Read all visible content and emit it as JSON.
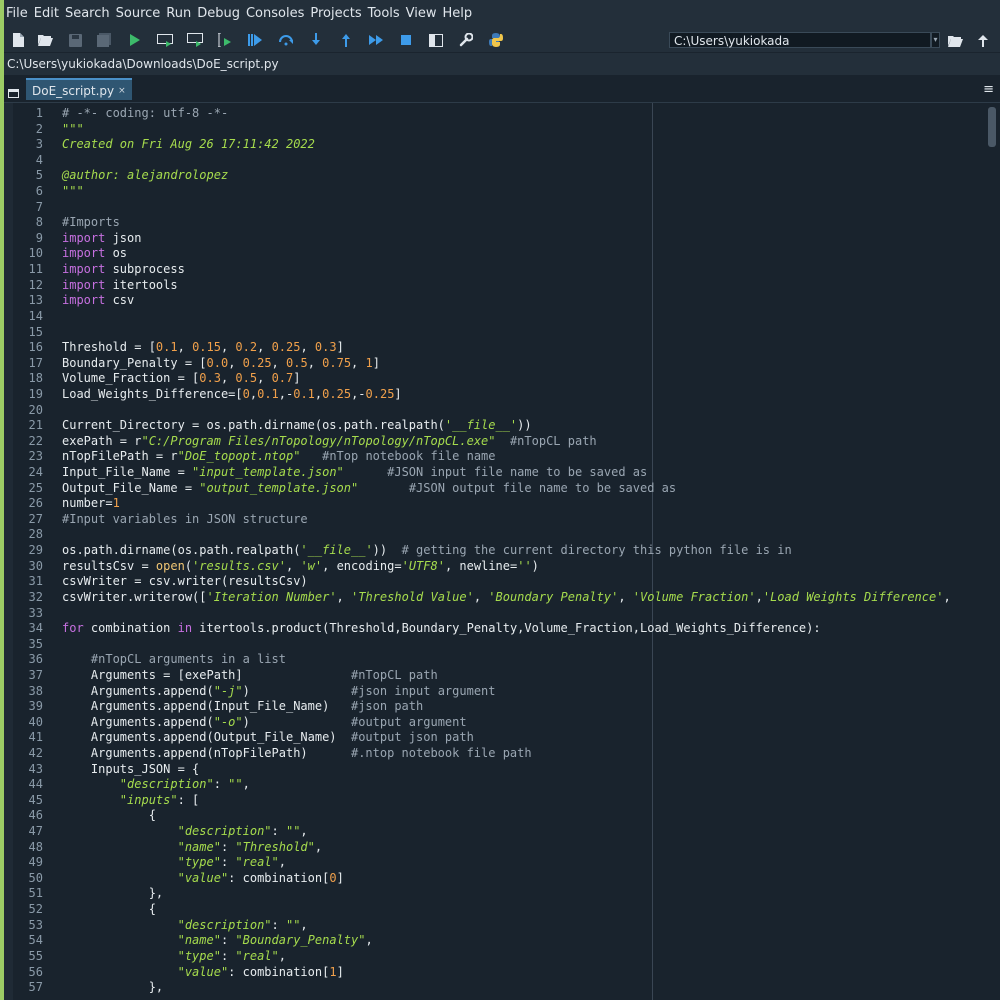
{
  "menu": [
    "File",
    "Edit",
    "Search",
    "Source",
    "Run",
    "Debug",
    "Consoles",
    "Projects",
    "Tools",
    "View",
    "Help"
  ],
  "toolbar_icons": [
    "new-file-icon",
    "open-file-icon",
    "save-icon",
    "save-all-icon",
    "run-icon",
    "run-cell-icon",
    "run-cell-advance-icon",
    "run-selection-icon",
    "debug-icon",
    "step-over-icon",
    "step-into-icon",
    "step-return-icon",
    "continue-icon",
    "stop-icon",
    "maximize-pane-icon",
    "preferences-icon",
    "python-path-icon"
  ],
  "cwd": {
    "value": "C:\\Users\\yukiokada"
  },
  "file_path": "C:\\Users\\yukiokada\\Downloads\\DoE_script.py",
  "tab": {
    "label": "DoE_script.py",
    "close": "×"
  },
  "code": {
    "lines": [
      [
        [
          "c",
          "# -*- coding: utf-8 -*-"
        ]
      ],
      [
        [
          "s",
          "\"\"\""
        ]
      ],
      [
        [
          "s",
          "Created on Fri Aug 26 17:11:42 2022"
        ]
      ],
      [
        [
          "t",
          ""
        ]
      ],
      [
        [
          "s",
          "@author: alejandrolopez"
        ]
      ],
      [
        [
          "s",
          "\"\"\""
        ]
      ],
      [
        [
          "t",
          ""
        ]
      ],
      [
        [
          "c",
          "#Imports"
        ]
      ],
      [
        [
          "k",
          "import"
        ],
        [
          "t",
          " json"
        ]
      ],
      [
        [
          "k",
          "import"
        ],
        [
          "t",
          " os"
        ]
      ],
      [
        [
          "k",
          "import"
        ],
        [
          "t",
          " subprocess"
        ]
      ],
      [
        [
          "k",
          "import"
        ],
        [
          "t",
          " itertools"
        ]
      ],
      [
        [
          "k",
          "import"
        ],
        [
          "t",
          " csv"
        ]
      ],
      [
        [
          "t",
          ""
        ]
      ],
      [
        [
          "t",
          ""
        ]
      ],
      [
        [
          "t",
          "Threshold = ["
        ],
        [
          "n",
          "0.1"
        ],
        [
          "t",
          ", "
        ],
        [
          "n",
          "0.15"
        ],
        [
          "t",
          ", "
        ],
        [
          "n",
          "0.2"
        ],
        [
          "t",
          ", "
        ],
        [
          "n",
          "0.25"
        ],
        [
          "t",
          ", "
        ],
        [
          "n",
          "0.3"
        ],
        [
          "t",
          "]"
        ]
      ],
      [
        [
          "t",
          "Boundary_Penalty = ["
        ],
        [
          "n",
          "0.0"
        ],
        [
          "t",
          ", "
        ],
        [
          "n",
          "0.25"
        ],
        [
          "t",
          ", "
        ],
        [
          "n",
          "0.5"
        ],
        [
          "t",
          ", "
        ],
        [
          "n",
          "0.75"
        ],
        [
          "t",
          ", "
        ],
        [
          "n",
          "1"
        ],
        [
          "t",
          "]"
        ]
      ],
      [
        [
          "t",
          "Volume_Fraction = ["
        ],
        [
          "n",
          "0.3"
        ],
        [
          "t",
          ", "
        ],
        [
          "n",
          "0.5"
        ],
        [
          "t",
          ", "
        ],
        [
          "n",
          "0.7"
        ],
        [
          "t",
          "]"
        ]
      ],
      [
        [
          "t",
          "Load_Weights_Difference=["
        ],
        [
          "n",
          "0"
        ],
        [
          "t",
          ","
        ],
        [
          "n",
          "0.1"
        ],
        [
          "t",
          ",-"
        ],
        [
          "n",
          "0.1"
        ],
        [
          "t",
          ","
        ],
        [
          "n",
          "0.25"
        ],
        [
          "t",
          ",-"
        ],
        [
          "n",
          "0.25"
        ],
        [
          "t",
          "]"
        ]
      ],
      [
        [
          "t",
          ""
        ]
      ],
      [
        [
          "t",
          "Current_Directory = os.path.dirname(os.path.realpath("
        ],
        [
          "s",
          "'__file__'"
        ],
        [
          "t",
          "))"
        ]
      ],
      [
        [
          "t",
          "exePath = r"
        ],
        [
          "s",
          "\"C:/Program Files/nTopology/nTopology/nTopCL.exe\""
        ],
        [
          "t",
          "  "
        ],
        [
          "c",
          "#nTopCL path"
        ]
      ],
      [
        [
          "t",
          "nTopFilePath = r"
        ],
        [
          "s",
          "\"DoE_topopt.ntop\""
        ],
        [
          "t",
          "   "
        ],
        [
          "c",
          "#nTop notebook file name"
        ]
      ],
      [
        [
          "t",
          "Input_File_Name = "
        ],
        [
          "s",
          "\"input_template.json\""
        ],
        [
          "t",
          "      "
        ],
        [
          "c",
          "#JSON input file name to be saved as"
        ]
      ],
      [
        [
          "t",
          "Output_File_Name = "
        ],
        [
          "s",
          "\"output_template.json\""
        ],
        [
          "t",
          "       "
        ],
        [
          "c",
          "#JSON output file name to be saved as"
        ]
      ],
      [
        [
          "t",
          "number="
        ],
        [
          "n",
          "1"
        ]
      ],
      [
        [
          "c",
          "#Input variables in JSON structure"
        ]
      ],
      [
        [
          "t",
          ""
        ]
      ],
      [
        [
          "t",
          "os.path.dirname(os.path.realpath("
        ],
        [
          "s",
          "'__file__'"
        ],
        [
          "t",
          "))  "
        ],
        [
          "c",
          "# getting the current directory this python file is in"
        ]
      ],
      [
        [
          "t",
          "resultsCsv = "
        ],
        [
          "f",
          "open"
        ],
        [
          "t",
          "("
        ],
        [
          "s",
          "'results.csv'"
        ],
        [
          "t",
          ", "
        ],
        [
          "s",
          "'w'"
        ],
        [
          "t",
          ", encoding="
        ],
        [
          "s",
          "'UTF8'"
        ],
        [
          "t",
          ", newline="
        ],
        [
          "s",
          "''"
        ],
        [
          "t",
          ")"
        ]
      ],
      [
        [
          "t",
          "csvWriter = csv.writer(resultsCsv)"
        ]
      ],
      [
        [
          "t",
          "csvWriter.writerow(["
        ],
        [
          "s",
          "'Iteration Number'"
        ],
        [
          "t",
          ", "
        ],
        [
          "s",
          "'Threshold Value'"
        ],
        [
          "t",
          ", "
        ],
        [
          "s",
          "'Boundary Penalty'"
        ],
        [
          "t",
          ", "
        ],
        [
          "s",
          "'Volume Fraction'"
        ],
        [
          "t",
          ","
        ],
        [
          "s",
          "'Load Weights Difference'"
        ],
        [
          "t",
          ","
        ]
      ],
      [
        [
          "t",
          ""
        ]
      ],
      [
        [
          "k",
          "for"
        ],
        [
          "t",
          " combination "
        ],
        [
          "k",
          "in"
        ],
        [
          "t",
          " itertools.product(Threshold,Boundary_Penalty,Volume_Fraction,Load_Weights_Difference):"
        ]
      ],
      [
        [
          "t",
          ""
        ]
      ],
      [
        [
          "t",
          "    "
        ],
        [
          "c",
          "#nTopCL arguments in a list"
        ]
      ],
      [
        [
          "t",
          "    Arguments = [exePath]               "
        ],
        [
          "c",
          "#nTopCL path"
        ]
      ],
      [
        [
          "t",
          "    Arguments.append("
        ],
        [
          "s",
          "\"-j\""
        ],
        [
          "t",
          ")              "
        ],
        [
          "c",
          "#json input argument"
        ]
      ],
      [
        [
          "t",
          "    Arguments.append(Input_File_Name)   "
        ],
        [
          "c",
          "#json path"
        ]
      ],
      [
        [
          "t",
          "    Arguments.append("
        ],
        [
          "s",
          "\"-o\""
        ],
        [
          "t",
          ")              "
        ],
        [
          "c",
          "#output argument"
        ]
      ],
      [
        [
          "t",
          "    Arguments.append(Output_File_Name)  "
        ],
        [
          "c",
          "#output json path"
        ]
      ],
      [
        [
          "t",
          "    Arguments.append(nTopFilePath)      "
        ],
        [
          "c",
          "#.ntop notebook file path"
        ]
      ],
      [
        [
          "t",
          "    Inputs_JSON = {"
        ]
      ],
      [
        [
          "t",
          "        "
        ],
        [
          "s",
          "\"description\""
        ],
        [
          "t",
          ": "
        ],
        [
          "s",
          "\"\""
        ],
        [
          "t",
          ","
        ]
      ],
      [
        [
          "t",
          "        "
        ],
        [
          "s",
          "\"inputs\""
        ],
        [
          "t",
          ": ["
        ]
      ],
      [
        [
          "t",
          "            {"
        ]
      ],
      [
        [
          "t",
          "                "
        ],
        [
          "s",
          "\"description\""
        ],
        [
          "t",
          ": "
        ],
        [
          "s",
          "\"\""
        ],
        [
          "t",
          ","
        ]
      ],
      [
        [
          "t",
          "                "
        ],
        [
          "s",
          "\"name\""
        ],
        [
          "t",
          ": "
        ],
        [
          "s",
          "\"Threshold\""
        ],
        [
          "t",
          ","
        ]
      ],
      [
        [
          "t",
          "                "
        ],
        [
          "s",
          "\"type\""
        ],
        [
          "t",
          ": "
        ],
        [
          "s",
          "\"real\""
        ],
        [
          "t",
          ","
        ]
      ],
      [
        [
          "t",
          "                "
        ],
        [
          "s",
          "\"value\""
        ],
        [
          "t",
          ": combination["
        ],
        [
          "n",
          "0"
        ],
        [
          "t",
          "]"
        ]
      ],
      [
        [
          "t",
          "            },"
        ]
      ],
      [
        [
          "t",
          "            {"
        ]
      ],
      [
        [
          "t",
          "                "
        ],
        [
          "s",
          "\"description\""
        ],
        [
          "t",
          ": "
        ],
        [
          "s",
          "\"\""
        ],
        [
          "t",
          ","
        ]
      ],
      [
        [
          "t",
          "                "
        ],
        [
          "s",
          "\"name\""
        ],
        [
          "t",
          ": "
        ],
        [
          "s",
          "\"Boundary_Penalty\""
        ],
        [
          "t",
          ","
        ]
      ],
      [
        [
          "t",
          "                "
        ],
        [
          "s",
          "\"type\""
        ],
        [
          "t",
          ": "
        ],
        [
          "s",
          "\"real\""
        ],
        [
          "t",
          ","
        ]
      ],
      [
        [
          "t",
          "                "
        ],
        [
          "s",
          "\"value\""
        ],
        [
          "t",
          ": combination["
        ],
        [
          "n",
          "1"
        ],
        [
          "t",
          "]"
        ]
      ],
      [
        [
          "t",
          "            },"
        ]
      ]
    ]
  },
  "colors": {
    "accent": "#9ccc65",
    "background": "#19232d",
    "keyword": "#c670e0",
    "string": "#a6dc4d",
    "comment": "#9aa6b2",
    "number": "#f0a04b"
  }
}
